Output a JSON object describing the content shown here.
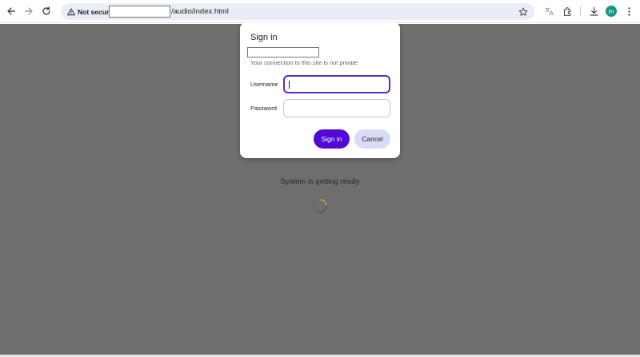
{
  "browser": {
    "security_label": "Not secure",
    "url_host": "",
    "url_path": "/audio/index.html",
    "profile_initial": "m",
    "avatar_color": "#16957f"
  },
  "icons": [
    "back-arrow-icon",
    "forward-arrow-icon",
    "reload-icon",
    "warning-icon",
    "star-icon",
    "translate-icon",
    "extensions-icon",
    "download-icon",
    "kebab-menu-icon",
    "loading-spinner-icon"
  ],
  "dialog": {
    "title": "Sign in",
    "host": "",
    "warning": "Your connection to this site is not private",
    "username_label": "Username",
    "username_value": "",
    "password_label": "Password",
    "password_value": "",
    "sign_in_label": "Sign in",
    "cancel_label": "Cancel",
    "accent_color": "#5109d6"
  },
  "page": {
    "status": "System is getting ready"
  }
}
